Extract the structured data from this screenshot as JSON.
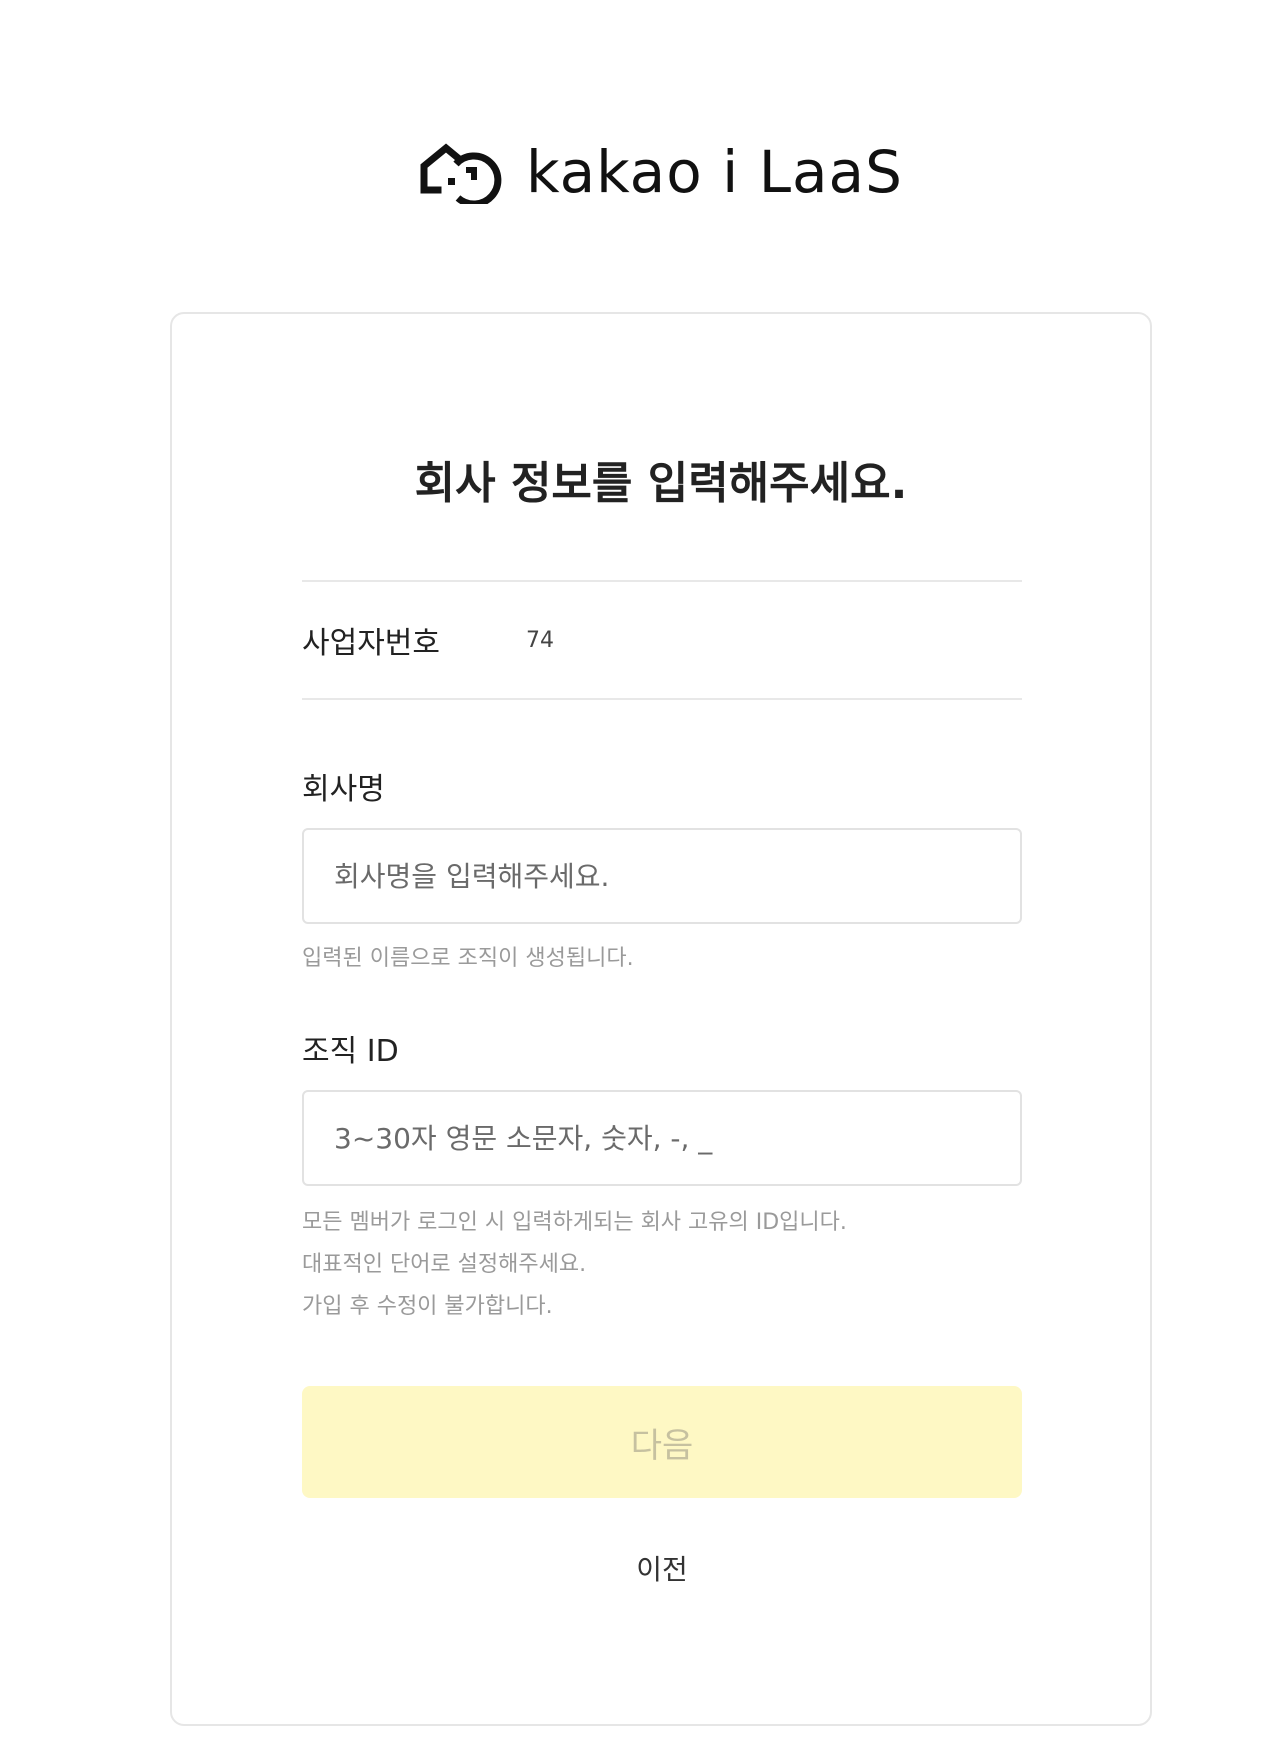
{
  "brand": {
    "logo_icon": "house-logo-icon",
    "name": "kakao i LaaS"
  },
  "form": {
    "title": "회사 정보를 입력해주세요.",
    "business_number": {
      "label": "사업자번호",
      "value": "74"
    },
    "company_name": {
      "label": "회사명",
      "value": "",
      "placeholder": "회사명을 입력해주세요.",
      "help": "입력된 이름으로 조직이 생성됩니다."
    },
    "organization_id": {
      "label": "조직 ID",
      "value": "",
      "placeholder": "3~30자 영문 소문자, 숫자, -, _",
      "help": [
        "모든 멤버가 로그인 시 입력하게되는 회사 고유의 ID입니다.",
        "대표적인 단어로 설정해주세요.",
        "가입 후 수정이 불가합니다."
      ]
    },
    "next_label": "다음",
    "prev_label": "이전"
  },
  "colors": {
    "accent_disabled_bg": "#fef8c4",
    "accent_disabled_text": "#c6c1a0",
    "border": "#e2e2e2",
    "help_text": "#9a9a9a"
  }
}
